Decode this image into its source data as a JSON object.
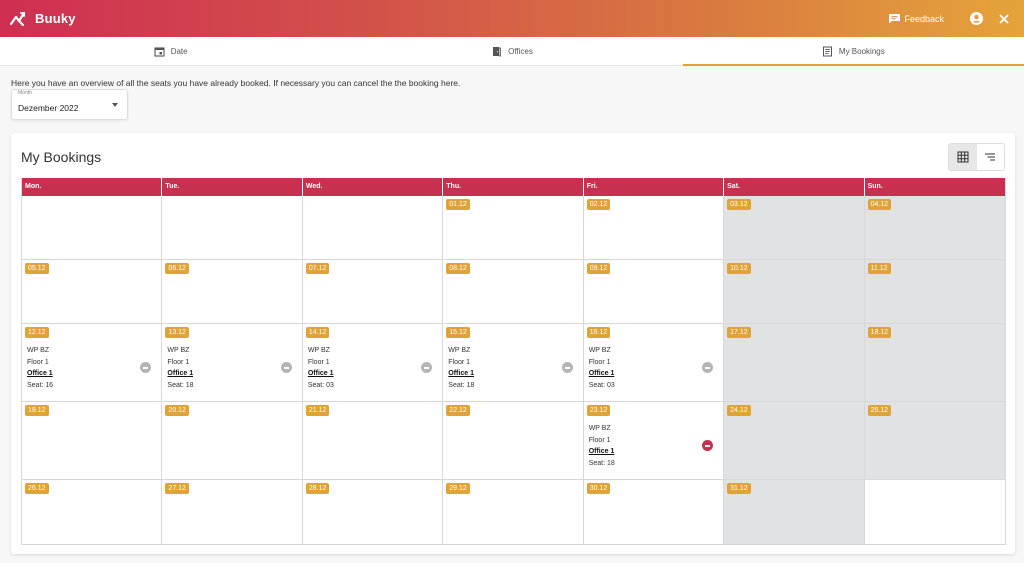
{
  "app": {
    "name": "Buuky"
  },
  "topbar": {
    "feedback_label": "Feedback"
  },
  "tabs": [
    {
      "label": "Date",
      "icon": "calendar-icon",
      "active": false
    },
    {
      "label": "Offices",
      "icon": "door-icon",
      "active": false
    },
    {
      "label": "My Bookings",
      "icon": "list-icon",
      "active": true
    }
  ],
  "intro": "Here you have an overview of all the seats you have already booked. If necessary you can cancel the the booking here.",
  "month_select": {
    "label": "Month",
    "value": "Dezember 2022"
  },
  "card": {
    "title": "My Bookings"
  },
  "calendar": {
    "weekdays": [
      "Mon.",
      "Tue.",
      "Wed.",
      "Thu.",
      "Fri.",
      "Sat.",
      "Sun."
    ],
    "weeks": [
      [
        {
          "date": ""
        },
        {
          "date": ""
        },
        {
          "date": ""
        },
        {
          "date": "01.12"
        },
        {
          "date": "02.12"
        },
        {
          "date": "03.12"
        },
        {
          "date": "04.12"
        }
      ],
      [
        {
          "date": "05.12"
        },
        {
          "date": "06.12"
        },
        {
          "date": "07.12"
        },
        {
          "date": "08.12"
        },
        {
          "date": "09.12"
        },
        {
          "date": "10.12"
        },
        {
          "date": "11.12"
        }
      ],
      [
        {
          "date": "12.12",
          "booking": {
            "building": "WP BZ",
            "floor": "Floor 1",
            "office": "Office 1",
            "seat": "Seat: 16"
          }
        },
        {
          "date": "13.12",
          "booking": {
            "building": "WP BZ",
            "floor": "Floor 1",
            "office": "Office 1",
            "seat": "Seat: 18"
          }
        },
        {
          "date": "14.12",
          "booking": {
            "building": "WP BZ",
            "floor": "Floor 1",
            "office": "Office 1",
            "seat": "Seat: 03"
          }
        },
        {
          "date": "15.12",
          "booking": {
            "building": "WP BZ",
            "floor": "Floor 1",
            "office": "Office 1",
            "seat": "Seat: 18"
          }
        },
        {
          "date": "16.12",
          "booking": {
            "building": "WP BZ",
            "floor": "Floor 1",
            "office": "Office 1",
            "seat": "Seat: 03"
          }
        },
        {
          "date": "17.12"
        },
        {
          "date": "18.12"
        }
      ],
      [
        {
          "date": "19.12"
        },
        {
          "date": "20.12"
        },
        {
          "date": "21.12"
        },
        {
          "date": "22.12"
        },
        {
          "date": "23.12",
          "booking": {
            "building": "WP BZ",
            "floor": "Floor 1",
            "office": "Office 1",
            "seat": "Seat: 18",
            "cancel_color": "#c8304f"
          }
        },
        {
          "date": "24.12"
        },
        {
          "date": "25.12"
        }
      ],
      [
        {
          "date": "26.12"
        },
        {
          "date": "27.12"
        },
        {
          "date": "28.12"
        },
        {
          "date": "29.12"
        },
        {
          "date": "30.12"
        },
        {
          "date": "31.12"
        },
        {
          "date": ""
        }
      ]
    ]
  },
  "colors": {
    "brand": "#c8304f",
    "accent": "#e0a338",
    "weekend": "#e1e2e4"
  }
}
